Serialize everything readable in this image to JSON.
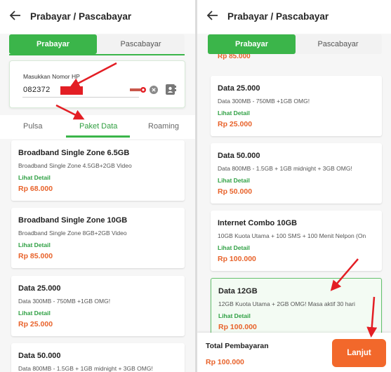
{
  "app": {
    "title": "Prabayar / Pascabayar"
  },
  "colors": {
    "brand_green": "#3bb54a",
    "price_orange": "#e8622a",
    "cta_orange": "#f2682b",
    "annotation_red": "#e31e24"
  },
  "segments": {
    "active": "Prabayar",
    "inactive": "Pascabayar"
  },
  "phone": {
    "label": "Masukkan Nomor HP",
    "value_visible": "082372",
    "operator_logo": "Telkomsel"
  },
  "tabs": [
    {
      "label": "Pulsa"
    },
    {
      "label": "Paket Data",
      "active": true
    },
    {
      "label": "Roaming"
    }
  ],
  "left_list": [
    {
      "title": "Broadband Single Zone 6.5GB",
      "desc": "Broadband Single Zone 4.5GB+2GB Video",
      "link": "Lihat Detail",
      "price": "Rp 68.000"
    },
    {
      "title": "Broadband Single Zone 10GB",
      "desc": "Broadband Single Zone 8GB+2GB Video",
      "link": "Lihat Detail",
      "price": "Rp 85.000"
    },
    {
      "title": "Data 25.000",
      "desc": "Data 300MB - 750MB +1GB OMG!",
      "link": "Lihat Detail",
      "price": "Rp 25.000"
    },
    {
      "title": "Data 50.000",
      "desc": "Data 800MB - 1.5GB + 1GB midnight + 3GB OMG!"
    }
  ],
  "right_partial_price": "Rp 85.000",
  "right_list": [
    {
      "title": "Data 25.000",
      "desc": "Data 300MB - 750MB +1GB OMG!",
      "link": "Lihat Detail",
      "price": "Rp 25.000"
    },
    {
      "title": "Data 50.000",
      "desc": "Data 800MB - 1.5GB + 1GB midnight + 3GB OMG!",
      "link": "Lihat Detail",
      "price": "Rp 50.000"
    },
    {
      "title": "Internet Combo 10GB",
      "desc": "10GB Kuota Utama + 100 SMS + 100 Menit Nelpon (On",
      "link": "Lihat Detail",
      "price": "Rp 100.000"
    },
    {
      "title": "Data 12GB",
      "desc": "12GB Kuota Utama + 2GB OMG! Masa aktif 30 hari",
      "link": "Lihat Detail",
      "price": "Rp 100.000",
      "selected": true
    }
  ],
  "footer": {
    "total_label": "Total Pembayaran",
    "total_value": "Rp 100.000",
    "cta": "Lanjut"
  }
}
